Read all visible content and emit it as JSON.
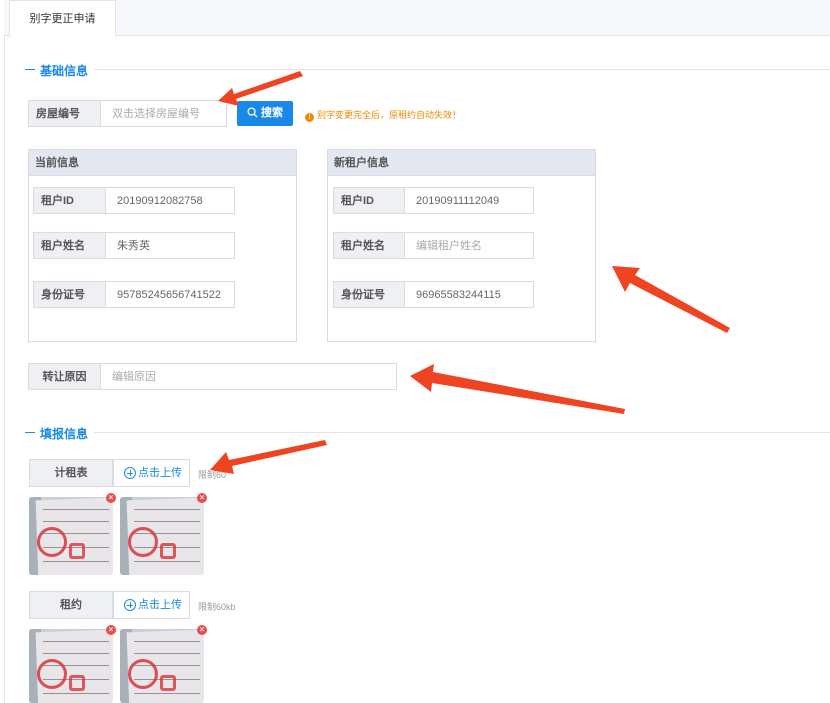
{
  "tabs": [
    {
      "label": "别字更正申请",
      "active": true
    }
  ],
  "sections": {
    "basic": {
      "title": "基础信息"
    },
    "fill": {
      "title": "填报信息"
    }
  },
  "room": {
    "label": "房屋编号",
    "placeholder": "双击选择房屋编号",
    "search_label": "搜索",
    "search_icon": "search-icon"
  },
  "warning": {
    "icon": "!",
    "text": "别字变更完全后，原租约自动失效！"
  },
  "current": {
    "title": "当前信息",
    "fields": [
      {
        "label": "租户ID",
        "value": "20190912082758"
      },
      {
        "label": "租户姓名",
        "value": "朱秀英"
      },
      {
        "label": "身份证号",
        "value": "95785245656741522"
      }
    ]
  },
  "new_tenant": {
    "title": "新租户信息",
    "fields": [
      {
        "label": "租户ID",
        "value": "20190911112049",
        "placeholder": ""
      },
      {
        "label": "租户姓名",
        "value": "",
        "placeholder": "编辑租户姓名"
      },
      {
        "label": "身份证号",
        "value": "96965583244115",
        "placeholder": ""
      }
    ]
  },
  "reason": {
    "label": "转让原因",
    "placeholder": "编辑原因"
  },
  "uploads": [
    {
      "label": "计租表",
      "button": "点击上传",
      "limit": "限制60",
      "images": 2
    },
    {
      "label": "租约",
      "button": "点击上传",
      "limit": "限制60kb",
      "images": 2
    }
  ],
  "colors": {
    "accent": "#1a88e8",
    "warning": "#f08a00",
    "arrow": "#ee4422",
    "delete": "#ef4b4b"
  }
}
